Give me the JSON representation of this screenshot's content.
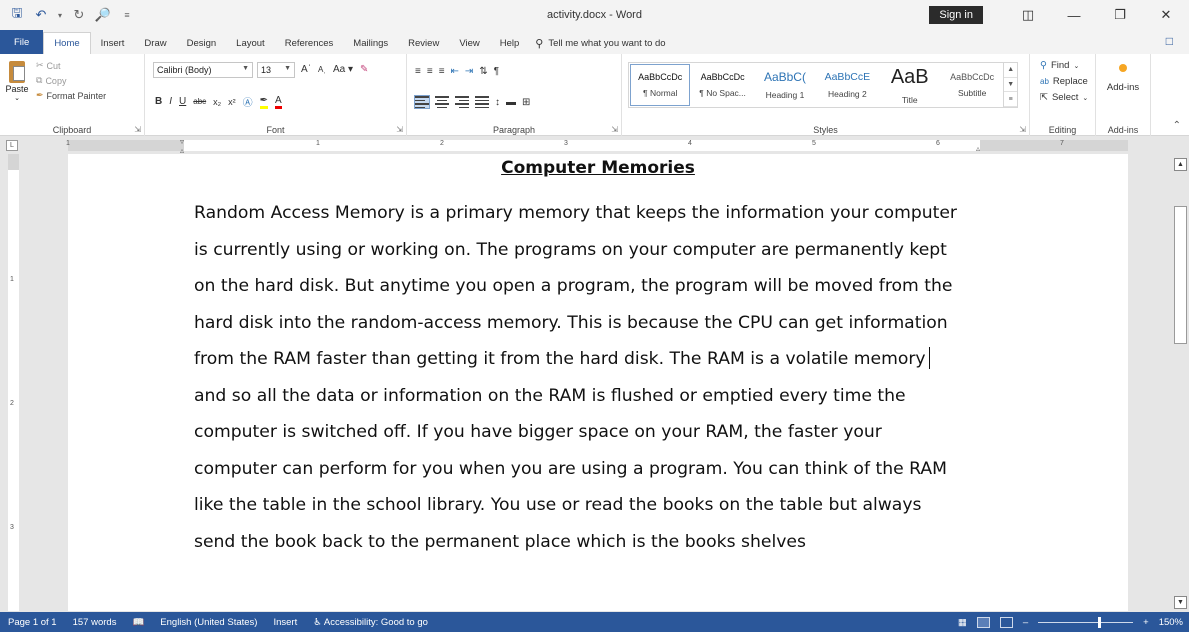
{
  "titlebar": {
    "title": "activity.docx  -  Word",
    "sign_in": "Sign in",
    "qat": {
      "save": "save-icon",
      "undo": "undo-icon",
      "redo": "redo-icon",
      "print_preview": "print-preview-icon"
    }
  },
  "tabs": [
    "File",
    "Home",
    "Insert",
    "Draw",
    "Design",
    "Layout",
    "References",
    "Mailings",
    "Review",
    "View",
    "Help"
  ],
  "active_tab": "Home",
  "tell_me": "Tell me what you want to do",
  "clipboard": {
    "paste": "Paste",
    "cut": "Cut",
    "copy": "Copy",
    "format_painter": "Format Painter",
    "label": "Clipboard"
  },
  "font": {
    "family": "Calibri (Body)",
    "size": "13",
    "label": "Font",
    "change_case": "Aa"
  },
  "paragraph": {
    "label": "Paragraph"
  },
  "styles": {
    "label": "Styles",
    "items": [
      {
        "preview": "AaBbCcDc",
        "name": "¶ Normal"
      },
      {
        "preview": "AaBbCcDc",
        "name": "¶ No Spac..."
      },
      {
        "preview": "AaBbC(",
        "name": "Heading 1"
      },
      {
        "preview": "AaBbCcE",
        "name": "Heading 2"
      },
      {
        "preview": "AaB",
        "name": "Title"
      },
      {
        "preview": "AaBbCcDc",
        "name": "Subtitle"
      }
    ]
  },
  "editing": {
    "find": "Find",
    "replace": "Replace",
    "select": "Select",
    "label": "Editing"
  },
  "addins": {
    "button": "Add-ins",
    "label": "Add-ins"
  },
  "ruler": {
    "h_ticks": [
      "1",
      "1",
      "2",
      "3",
      "4",
      "5",
      "6",
      "7"
    ],
    "v_ticks": [
      "1",
      "2",
      "3"
    ],
    "corner": "L"
  },
  "document": {
    "title": "Computer Memories",
    "lines": [
      "Random Access Memory is a primary memory that keeps the information your computer",
      "is currently using or working on. The programs on your computer are permanently kept",
      "on the hard disk. But anytime you open a program, the program will be moved from the",
      "hard disk into the random-access memory. This is because the CPU can get information",
      "from the RAM faster than getting it from the hard disk. The RAM is a volatile memory",
      "and so all the data or information on the RAM is flushed or emptied every time the",
      "computer is switched off. If you have bigger space on your RAM, the faster your",
      "computer can perform for you when you are using a program. You can think of the RAM",
      "like the table in the school library. You use or read the books on the table but always",
      "send the book back to the permanent place which is the books shelves"
    ]
  },
  "status": {
    "page": "Page 1 of 1",
    "words": "157 words",
    "language": "English (United States)",
    "mode": "Insert",
    "accessibility": "Accessibility: Good to go",
    "zoom": "150%",
    "zoom_minus": "–",
    "zoom_plus": "+"
  }
}
